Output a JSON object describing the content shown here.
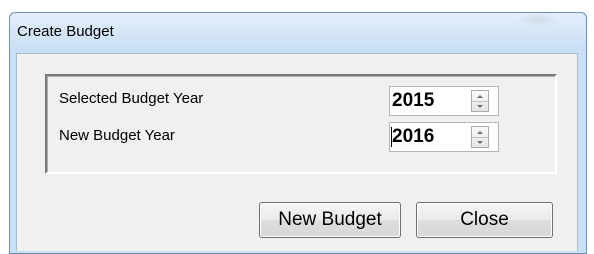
{
  "window": {
    "title": "Create Budget"
  },
  "form": {
    "selected_label": "Selected Budget Year",
    "selected_value": "2015",
    "new_label": "New Budget Year",
    "new_value": "2016"
  },
  "buttons": {
    "new_budget": "New Budget",
    "close": "Close"
  },
  "icons": {
    "spin_up": "chevron-up-icon",
    "spin_down": "chevron-down-icon"
  },
  "colors": {
    "window_frame": "#c8dff4",
    "client_background": "#f0f0f0"
  }
}
